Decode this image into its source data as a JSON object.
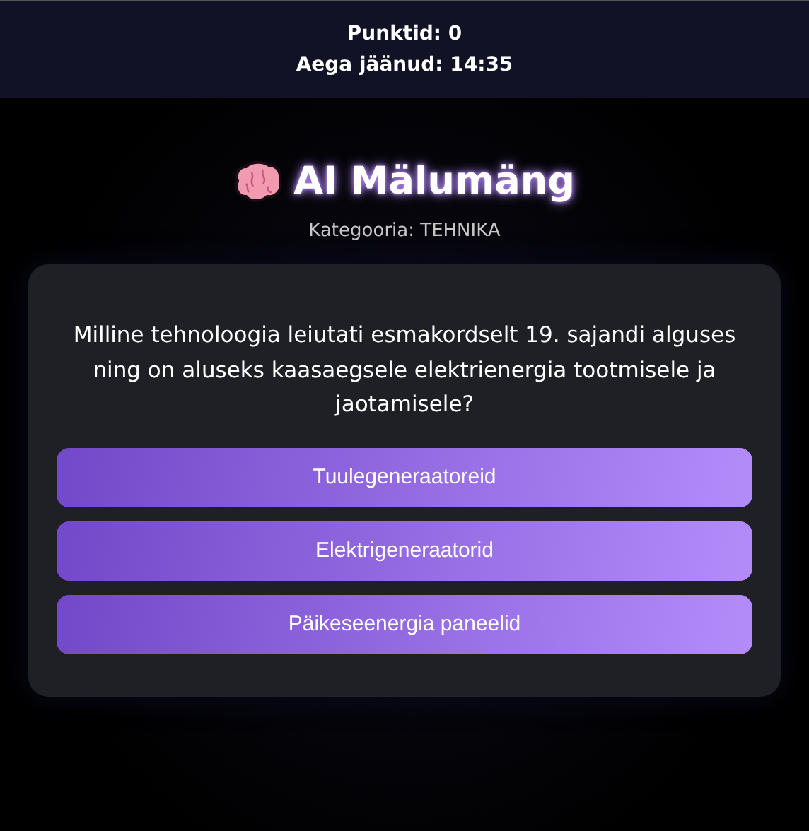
{
  "header": {
    "score": "Punktid: 0",
    "time_left": "Aega jäänud: 14:35"
  },
  "title": "AI Mälumäng",
  "category": "Kategooria: TEHNIKA",
  "question": "Milline tehnoloogia leiutati esmakordselt 19. sajandi alguses ning on aluseks kaasaegsele elektrienergia tootmisele ja jaotamisele?",
  "answers": [
    "Tuulegeneraatoreid",
    "Elektrigeneraatorid",
    "Päikeseenergia paneelid"
  ]
}
